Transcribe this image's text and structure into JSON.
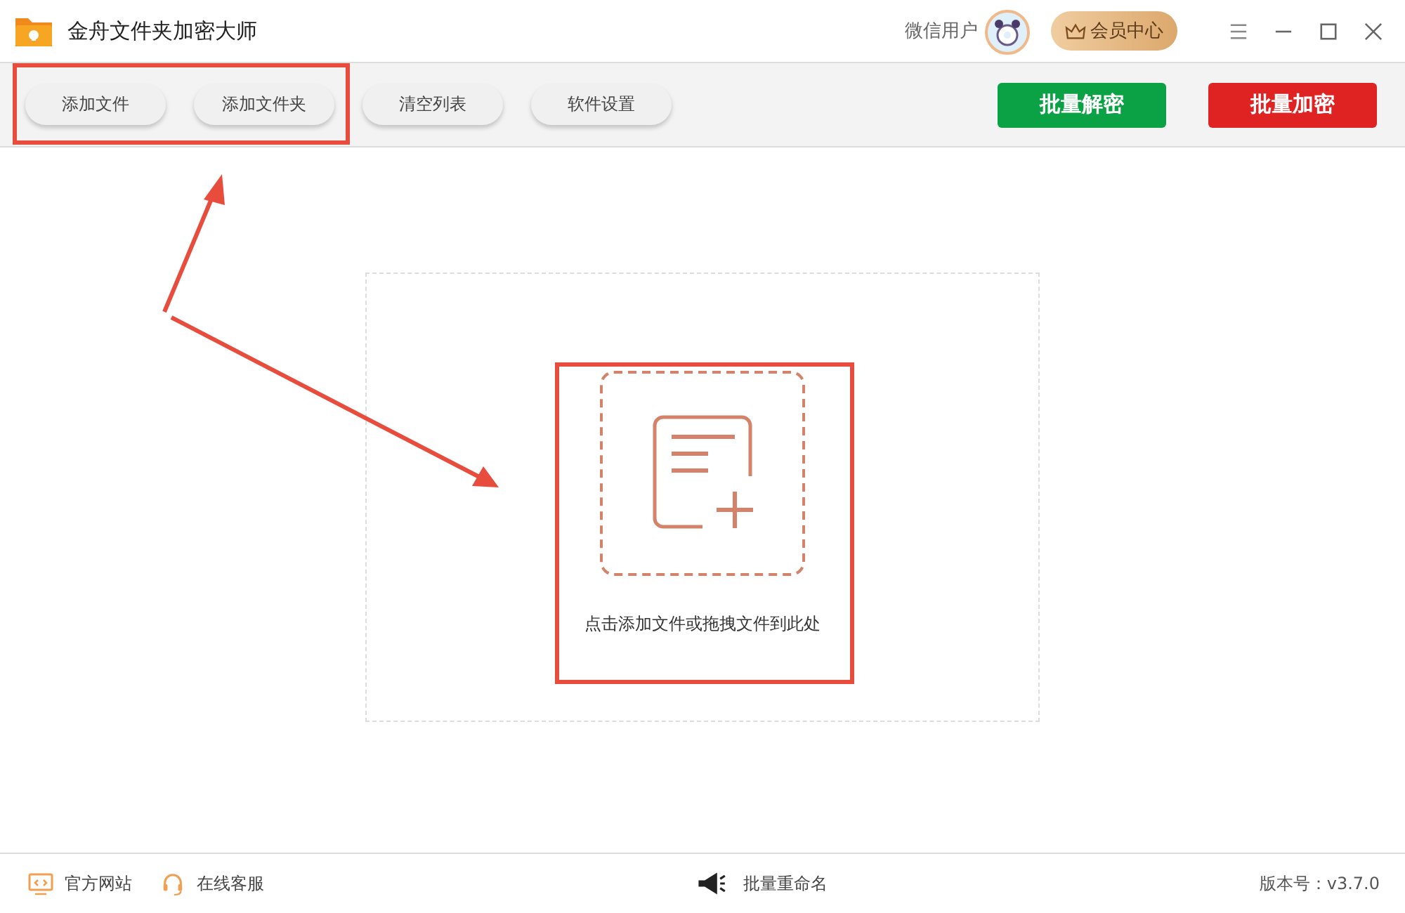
{
  "window": {
    "title": "金舟文件夹加密大师"
  },
  "user": {
    "name": "微信用户"
  },
  "vip_button": {
    "label": "会员中心"
  },
  "toolbar": {
    "buttons": [
      {
        "label": "添加文件"
      },
      {
        "label": "添加文件夹"
      },
      {
        "label": "清空列表"
      },
      {
        "label": "软件设置"
      }
    ],
    "actions": [
      {
        "label": "批量解密",
        "kind": "decrypt"
      },
      {
        "label": "批量加密",
        "kind": "encrypt"
      }
    ]
  },
  "drop_zone": {
    "hint": "点击添加文件或拖拽文件到此处"
  },
  "status_bar": {
    "links": [
      {
        "label": "官方网站",
        "kind": "website"
      },
      {
        "label": "在线客服",
        "kind": "support"
      }
    ],
    "rename": "批量重命名",
    "version": "版本号：v3.7.0"
  }
}
